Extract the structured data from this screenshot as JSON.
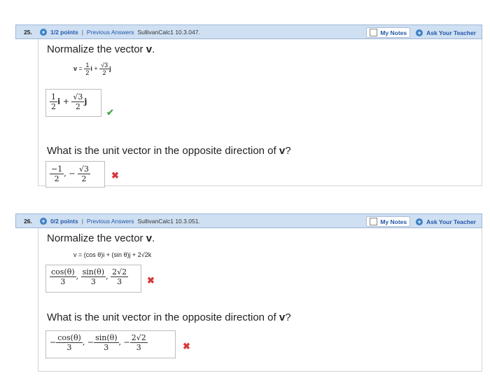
{
  "problems": [
    {
      "number": "25.",
      "points": "1/2 points",
      "separator": "|",
      "previous_answers": "Previous Answers",
      "source": "SullivanCalc1 10.3.047.",
      "my_notes": "My Notes",
      "ask_teacher": "Ask Your Teacher",
      "q1_text": "Normalize the vector ",
      "q1_bold": "v",
      "q1_end": ".",
      "equation": {
        "lhs": "v",
        "eq": "=",
        "t1_num": "1",
        "t1_den": "2",
        "t1_unit": "i",
        "plus": "+",
        "t2_num": "√3",
        "t2_den": "2",
        "t2_unit": "j"
      },
      "answer1": {
        "f1_num": "1",
        "f1_den": "2",
        "u1": "i",
        "plus": "+",
        "f2_num": "√3",
        "f2_den": "2",
        "u2": "j",
        "status": "correct"
      },
      "q2_text": "What is the unit vector in the opposite direction of ",
      "q2_bold": "v",
      "q2_end": "?",
      "answer2": {
        "f1_num": "−1",
        "f1_den": "2",
        "comma": ",",
        "minus": "−",
        "f2_num": "√3",
        "f2_den": "2",
        "status": "incorrect"
      }
    },
    {
      "number": "26.",
      "points": "0/2 points",
      "separator": "|",
      "previous_answers": "Previous Answers",
      "source": "SullivanCalc1 10.3.051.",
      "my_notes": "My Notes",
      "ask_teacher": "Ask Your Teacher",
      "q1_text": "Normalize the vector ",
      "q1_bold": "v",
      "q1_end": ".",
      "equation": {
        "text": "v = (cos θ)i + (sin θ)j + 2√2k"
      },
      "answer1": {
        "f1_num": "cos(θ)",
        "f1_den": "3",
        "comma": ",",
        "f2_num": "sin(θ)",
        "f2_den": "3",
        "f3_num": "2√2",
        "f3_den": "3",
        "status": "incorrect"
      },
      "q2_text": "What is the unit vector in the opposite direction of ",
      "q2_bold": "v",
      "q2_end": "?",
      "answer2": {
        "minus": "−",
        "f1_num": "cos(θ)",
        "f1_den": "3",
        "comma": ",",
        "f2_num": "sin(θ)",
        "f2_den": "3",
        "f3_num": "2√2",
        "f3_den": "3",
        "status": "incorrect"
      }
    }
  ],
  "icons": {
    "plus": "+",
    "check": "✔",
    "cross": "✖"
  },
  "colors": {
    "header_bg": "#cfe0f3",
    "link": "#2458a8",
    "correct": "#4aa84a",
    "incorrect": "#d9373c"
  }
}
